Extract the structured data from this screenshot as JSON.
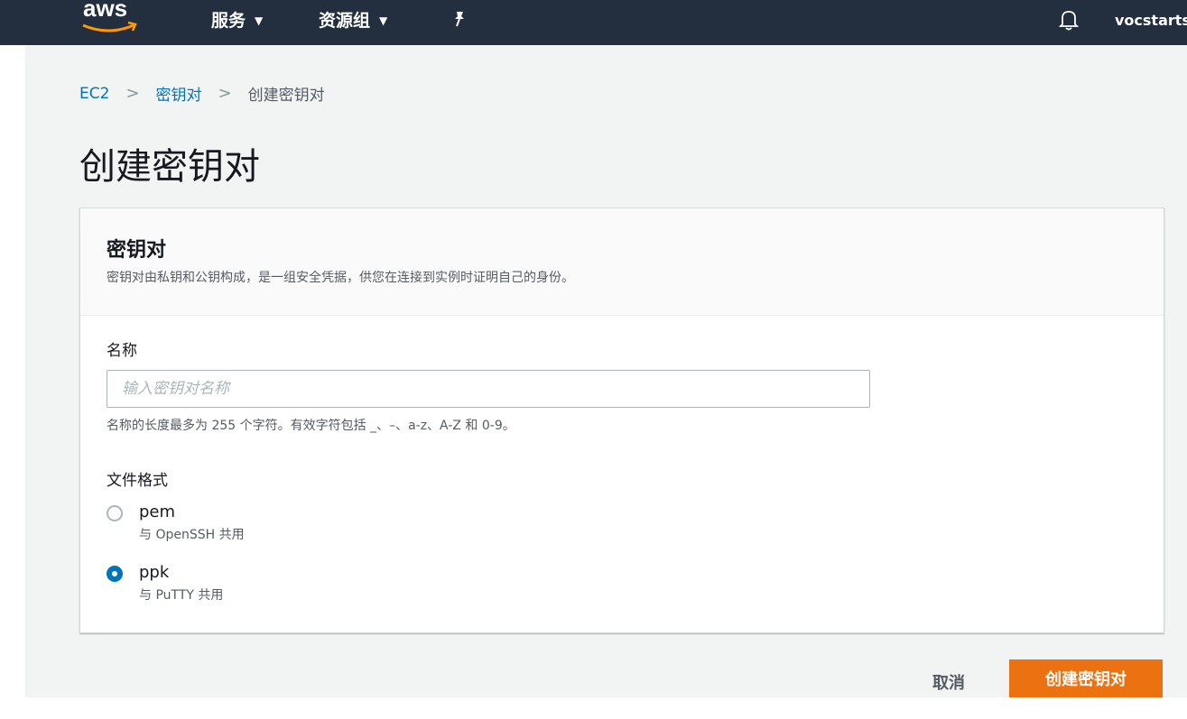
{
  "nav": {
    "logo_text": "aws",
    "services_label": "服务",
    "resource_groups_label": "资源组",
    "user_label": "vocstarts",
    "icons": [
      "chevron-down-icon",
      "pin-icon",
      "bell-icon"
    ]
  },
  "breadcrumb": {
    "items": [
      "EC2",
      "密钥对"
    ],
    "current": "创建密钥对"
  },
  "page_title": "创建密钥对",
  "panel": {
    "title": "密钥对",
    "description": "密钥对由私钥和公钥构成，是一组安全凭据，供您在连接到实例时证明自己的身份。"
  },
  "name_field": {
    "label": "名称",
    "placeholder": "输入密钥对名称",
    "value": "",
    "hint": "名称的长度最多为 255 个字符。有效字符包括 _、–、a-z、A-Z 和 0-9。"
  },
  "file_format": {
    "label": "文件格式",
    "options": [
      {
        "value": "pem",
        "description": "与 OpenSSH 共用",
        "checked": false
      },
      {
        "value": "ppk",
        "description": "与 PuTTY 共用",
        "checked": true
      }
    ]
  },
  "actions": {
    "cancel_label": "取消",
    "create_label": "创建密钥对"
  },
  "colors": {
    "nav_bg": "#232f3e",
    "link": "#0073bb",
    "primary": "#ec7211",
    "page_bg": "#f2f3f3"
  }
}
